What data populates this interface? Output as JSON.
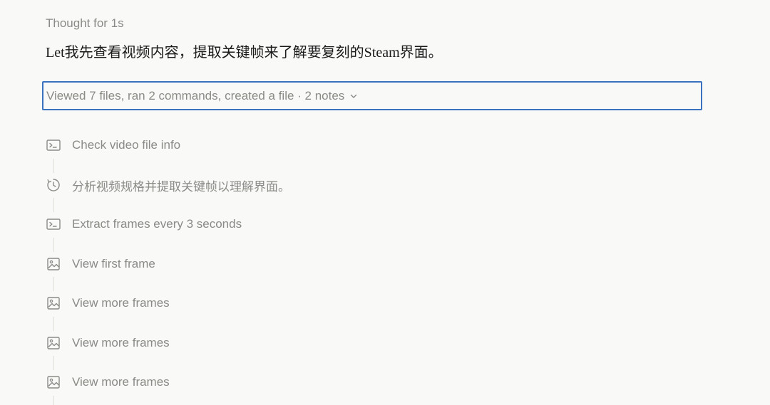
{
  "thought": "Thought for 1s",
  "intro": "Let我先查看视频内容，提取关键帧来了解要复刻的Steam界面。",
  "summary": "Viewed 7 files, ran 2 commands, created a file · 2 notes",
  "colors": {
    "background": "#f9f9f7",
    "muted_text": "#8a8a86",
    "focus_border": "#3a72c0",
    "connector": "#deded9"
  },
  "steps": [
    {
      "icon": "terminal-icon",
      "label": "Check video file info"
    },
    {
      "icon": "clock-icon",
      "label": "分析视频规格并提取关键帧以理解界面。"
    },
    {
      "icon": "terminal-icon",
      "label": "Extract frames every 3 seconds"
    },
    {
      "icon": "image-icon",
      "label": "View first frame"
    },
    {
      "icon": "image-icon",
      "label": "View more frames"
    },
    {
      "icon": "image-icon",
      "label": "View more frames"
    },
    {
      "icon": "image-icon",
      "label": "View more frames"
    }
  ]
}
